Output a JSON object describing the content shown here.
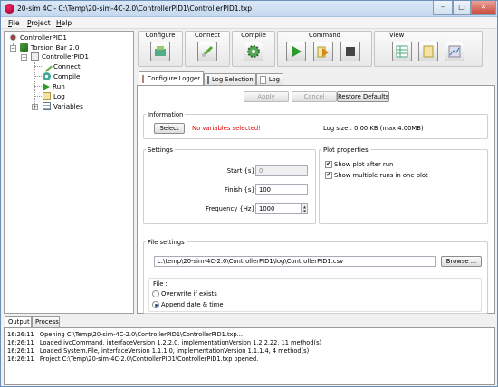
{
  "window": {
    "title": "20-sim 4C - C:\\Temp\\20-sim-4C-2.0\\ControllerPID1\\ControllerPID1.txp",
    "controls": [
      "–",
      "□",
      "✕"
    ]
  },
  "menu": [
    {
      "accel": "F",
      "rest": "ile"
    },
    {
      "accel": "P",
      "rest": "roject"
    },
    {
      "accel": "H",
      "rest": "elp"
    }
  ],
  "tree": {
    "root": "ControllerPID1",
    "child": "Torsion Bar 2.0",
    "subchild": "ControllerPID1",
    "items": [
      "Connect",
      "Compile",
      "Run",
      "Log",
      "Variables"
    ]
  },
  "toolbar": {
    "configure": "Configure",
    "connect": "Connect",
    "compile": "Compile",
    "command": "Command",
    "view": "View"
  },
  "tabs": [
    "Configure Logger",
    "Log Selection",
    "Log"
  ],
  "buttons": {
    "apply": "Apply",
    "cancel": "Cancel",
    "restore": "Restore Defaults",
    "select": "Select",
    "browse": "Browse ..."
  },
  "information": {
    "title": "Information",
    "warning": "No variables selected!",
    "log_size": "Log size : 0.00 KB (max 4.00MB)"
  },
  "settings": {
    "title": "Settings",
    "start_label": "Start {s}:",
    "start_value": "0",
    "finish_label": "Finish {s}:",
    "finish_value": "100",
    "frequency_label": "Frequency {Hz}:",
    "frequency_value": "1000"
  },
  "plot": {
    "title": "Plot properties",
    "show_plot": "Show plot after run",
    "show_multiple": "Show multiple runs in one plot"
  },
  "file_settings": {
    "title": "File settings",
    "path": "c:\\temp\\20-sim-4C-2.0\\ControllerPID1\\log\\ControllerPID1.csv",
    "file_group": "File :",
    "overwrite": "Overwrite if exists",
    "append": "Append date & time"
  },
  "output": {
    "tabs": [
      "Output",
      "Process"
    ],
    "lines": [
      {
        "time": "16:26:11",
        "text": "Opening C:\\Temp\\20-sim-4C-2.0\\ControllerPID1\\ControllerPID1.txp..."
      },
      {
        "time": "16:26:11",
        "text": "Loaded ivcCommand, interfaceVersion 1.2.2.0,  implementationVersion 1.2.2.22,  11 method(s)"
      },
      {
        "time": "16:26:11",
        "text": "Loaded System.File, interfaceVersion 1.1.1.0,  implementationVersion 1.1.1.4,  4 method(s)"
      },
      {
        "time": "16:26:11",
        "text": "Project C:\\Temp\\20-sim-4C-2.0\\ControllerPID1\\ControllerPID1.txp opened."
      }
    ]
  },
  "colors": {
    "warning": "#e00000",
    "accent": "#3c7fb1"
  }
}
